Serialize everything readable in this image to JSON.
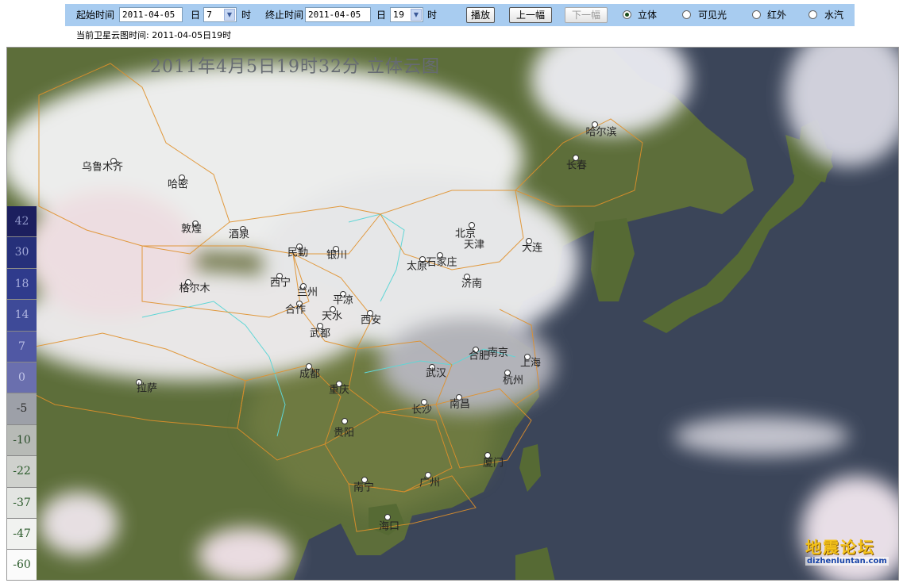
{
  "toolbar": {
    "start_label": "起始时间",
    "start_date": "2011-04-05",
    "day_label_1": "日",
    "start_hour": "7",
    "hour_label_1": "时",
    "end_label": "终止时间",
    "end_date": "2011-04-05",
    "day_label_2": "日",
    "end_hour": "19",
    "hour_label_2": "时",
    "play_label": "播放",
    "prev_label": "上一幅",
    "next_label": "下一幅",
    "modes": [
      {
        "label": "立体",
        "selected": true
      },
      {
        "label": "可见光",
        "selected": false
      },
      {
        "label": "红外",
        "selected": false
      },
      {
        "label": "水汽",
        "selected": false
      }
    ]
  },
  "current_time": "当前卫星云图时间: 2011-04-05日19时",
  "map": {
    "title": "2011年4月5日19时32分  立体云图",
    "cities": [
      {
        "name": "哈尔滨"
      },
      {
        "name": "长春"
      },
      {
        "name": "乌鲁木齐"
      },
      {
        "name": "哈密"
      },
      {
        "name": "敦煌"
      },
      {
        "name": "酒泉"
      },
      {
        "name": "北京"
      },
      {
        "name": "天津"
      },
      {
        "name": "大连"
      },
      {
        "name": "民勤"
      },
      {
        "name": "银川"
      },
      {
        "name": "太原"
      },
      {
        "name": "石家庄"
      },
      {
        "name": "西宁"
      },
      {
        "name": "兰州"
      },
      {
        "name": "格尔木"
      },
      {
        "name": "济南"
      },
      {
        "name": "合作"
      },
      {
        "name": "平凉"
      },
      {
        "name": "天水"
      },
      {
        "name": "西安"
      },
      {
        "name": "武都"
      },
      {
        "name": "合肥"
      },
      {
        "name": "南京"
      },
      {
        "name": "上海"
      },
      {
        "name": "成都"
      },
      {
        "name": "武汉"
      },
      {
        "name": "杭州"
      },
      {
        "name": "拉萨"
      },
      {
        "name": "重庆"
      },
      {
        "name": "长沙"
      },
      {
        "name": "南昌"
      },
      {
        "name": "贵阳"
      },
      {
        "name": "厦门"
      },
      {
        "name": "南宁"
      },
      {
        "name": "广州"
      },
      {
        "name": "海口"
      }
    ],
    "scale": [
      "42",
      "30",
      "18",
      "14",
      "7",
      "0",
      "-5",
      "-10",
      "-22",
      "-37",
      "-47",
      "-60"
    ],
    "watermark": "地震论坛",
    "watermark_url": "dizhenluntan.com"
  },
  "colors": {
    "toolbar_bg": "#a8ccf0",
    "ocean": "#3b4559",
    "land": "#5d6e3a",
    "cloud": "#f4f4f6",
    "border_orange": "#e0902a",
    "border_cyan": "#5fd6d6"
  }
}
